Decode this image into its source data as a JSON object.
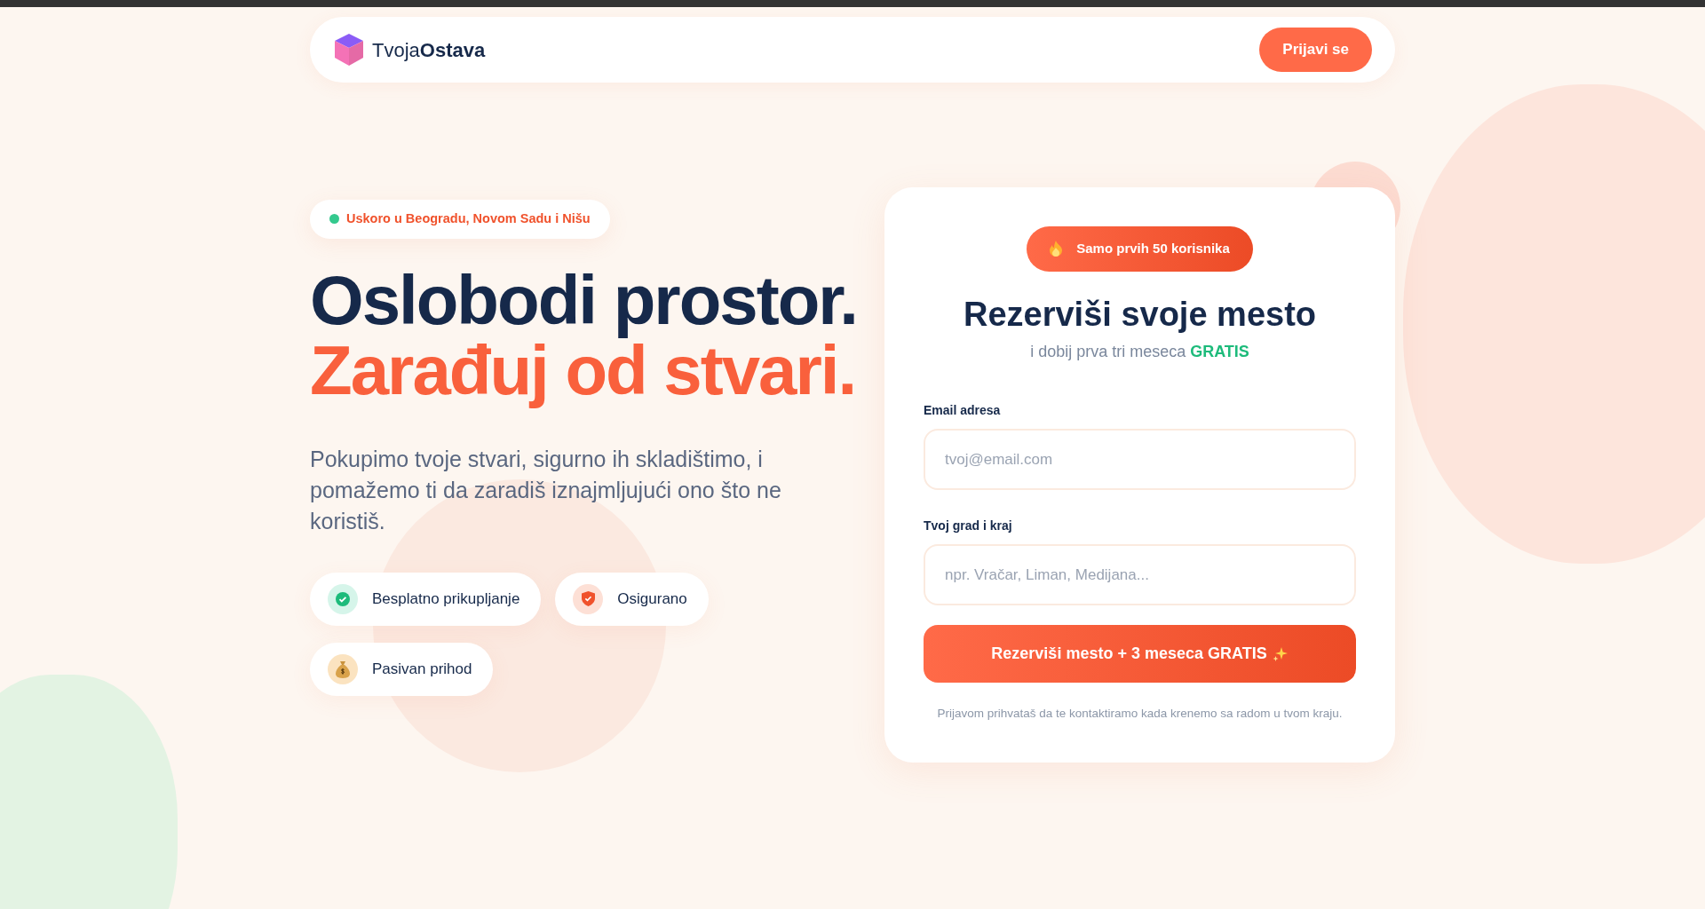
{
  "navbar": {
    "logo": "Tvoja**Ostava**",
    "login_button": "Prijavi se"
  },
  "hero": {
    "badge": {
      "text": "Uskoro u Beogradu, Novom Sadu i Nišu",
      "color": "#34c98e"
    },
    "headline": [
      {
        "text": "Oslobodi prostor.",
        "kind": "plain"
      },
      {
        "text": "Zarađuj od stvari.",
        "kind": "accent"
      }
    ],
    "description": "Pokupimo tvoje stvari, sigurno ih skladištimo, i pomažemo ti da zaradiš iznajmljujući ono što ne koristiš.",
    "features": [
      {
        "label": "Besplatno prikupljanje",
        "kind": "check"
      },
      {
        "label": "Osigurano",
        "kind": "shield"
      },
      {
        "label": "Pasivan prihod",
        "kind": "money"
      }
    ]
  },
  "signup": {
    "badge": "Samo prvih 50 korisnika",
    "title": "Rezerviši svoje mesto",
    "subtitle": "i dobij prva tri meseca **GRATIS**",
    "fields": [
      {
        "label": "Email adresa",
        "placeholder": "tvoj@email.com"
      },
      {
        "label": "Tvoj grad i kraj",
        "placeholder": "npr. Vračar, Liman, Medijana..."
      }
    ],
    "submit": "Rezerviši mesto + 3 meseca GRATIS",
    "note": "Prijavom prihvataš da te kontaktiramo kada krenemo sa radom u tvom kraju."
  }
}
